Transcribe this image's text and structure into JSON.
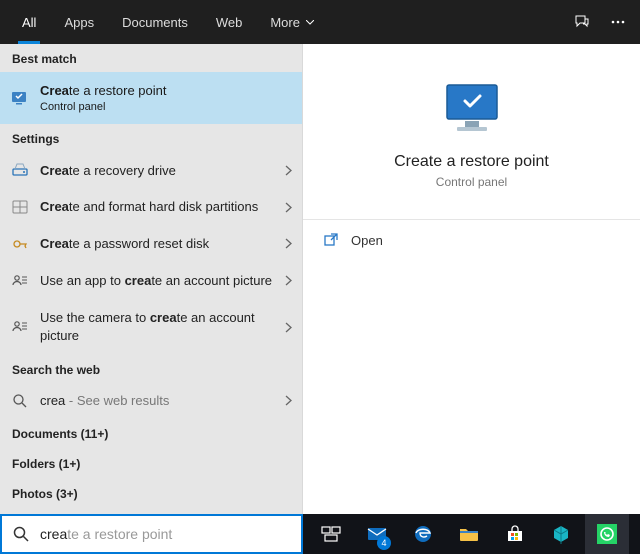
{
  "tabs": {
    "items": [
      {
        "label": "All",
        "selected": true
      },
      {
        "label": "Apps"
      },
      {
        "label": "Documents"
      },
      {
        "label": "Web"
      },
      {
        "label": "More"
      }
    ]
  },
  "left": {
    "bestMatchHeader": "Best match",
    "bestMatch": {
      "title_pre": "Crea",
      "title_post": "te a restore point",
      "subtitle": "Control panel"
    },
    "settingsHeader": "Settings",
    "settings": [
      {
        "pre": "Crea",
        "post": "te a recovery drive"
      },
      {
        "pre": "Crea",
        "post": "te and format hard disk partitions"
      },
      {
        "pre": "Crea",
        "post": "te a password reset disk"
      },
      {
        "pre1": "Use an app to ",
        "bold": "crea",
        "post": "te an account picture"
      },
      {
        "pre1": "Use the camera to ",
        "bold": "crea",
        "post": "te an account picture"
      }
    ],
    "searchWebHeader": "Search the web",
    "web": {
      "query": "crea",
      "suffix": " - See web results"
    },
    "documentsLine": "Documents (11+)",
    "foldersLine": "Folders (1+)",
    "photosLine": "Photos (3+)"
  },
  "preview": {
    "title": "Create a restore point",
    "subtitle": "Control panel",
    "open": "Open"
  },
  "search": {
    "typed": "crea",
    "ghost": "te a restore point"
  },
  "taskbar": {
    "mailBadge": "4"
  }
}
